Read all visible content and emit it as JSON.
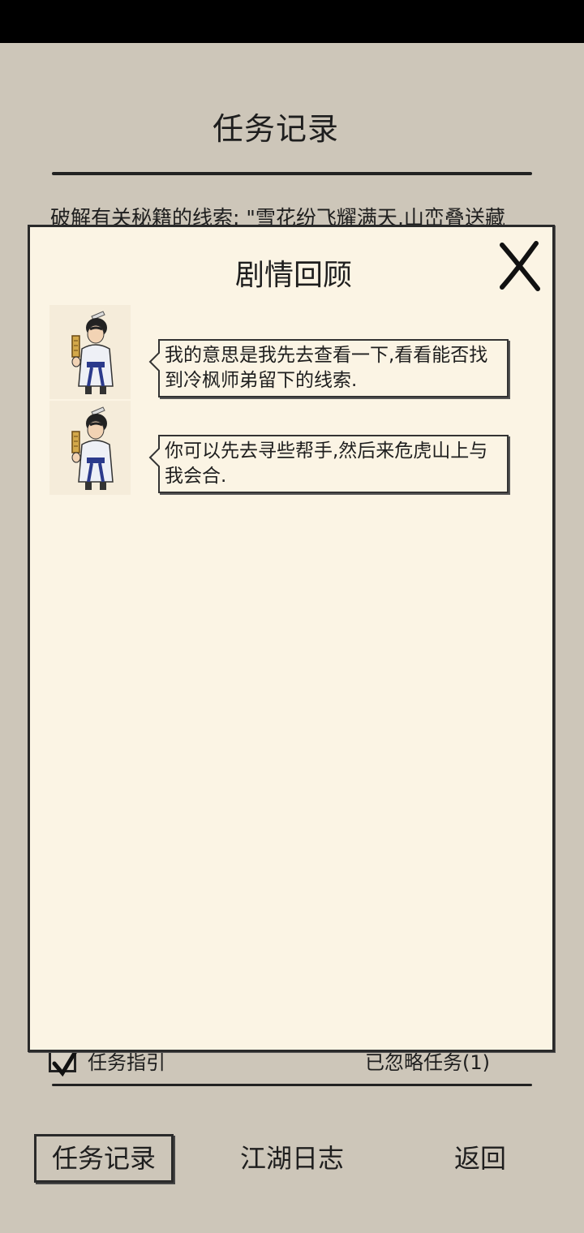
{
  "header": {
    "title": "任务记录"
  },
  "background": {
    "task_clue_text": "破解有关秘籍的线索: \"雪花纷飞耀满天,山峦叠送藏",
    "guide_label": "任务指引",
    "ignored_label": "已忽略任务(1)"
  },
  "modal": {
    "title": "剧情回顾",
    "close_icon": "close-icon",
    "messages": [
      {
        "avatar": "scholar-avatar",
        "text": "我的意思是我先去查看一下,看看能否找到冷枫师弟留下的线索."
      },
      {
        "avatar": "scholar-avatar",
        "text": "你可以先去寻些帮手,然后来危虎山上与我会合."
      }
    ]
  },
  "bottom_nav": {
    "items": [
      {
        "label": "任务记录",
        "active": true
      },
      {
        "label": "江湖日志",
        "active": false
      },
      {
        "label": "返回",
        "active": false
      }
    ]
  }
}
